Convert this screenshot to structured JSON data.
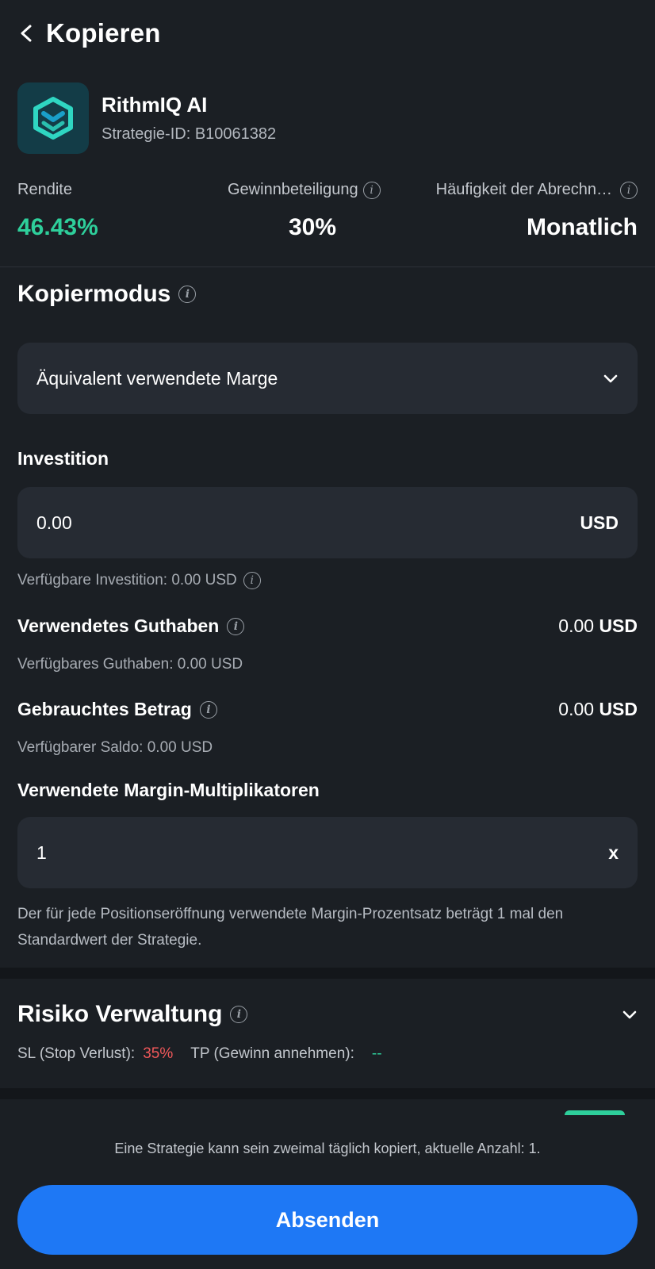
{
  "header": {
    "title": "Kopieren"
  },
  "strategy": {
    "name": "RithmIQ AI",
    "id_text": "Strategie-ID: B10061382"
  },
  "stats": {
    "return_label": "Rendite",
    "return_value": "46.43%",
    "profit_share_label": "Gewinnbeteiligung",
    "profit_share_value": "30%",
    "settlement_label": "Häufigkeit der Abrechn…",
    "settlement_value": "Monatlich"
  },
  "copy_mode": {
    "title": "Kopiermodus",
    "selected": "Äquivalent verwendete Marge"
  },
  "investment": {
    "label": "Investition",
    "value": "0.00",
    "unit": "USD",
    "available": "Verfügbare Investition: 0.00 USD"
  },
  "used_balance": {
    "label": "Verwendetes Guthaben",
    "value": "0.00",
    "unit": "USD",
    "available": "Verfügbares Guthaben: 0.00 USD"
  },
  "used_amount": {
    "label": "Gebrauchtes Betrag",
    "value": "0.00",
    "unit": "USD",
    "available": "Verfügbarer Saldo: 0.00 USD"
  },
  "margin_multiplier": {
    "label": "Verwendete Margin-Multiplikatoren",
    "value": "1",
    "unit": "x",
    "description": "Der für jede Positionseröffnung verwendete Margin-Prozentsatz beträgt 1 mal den Standardwert der Strategie."
  },
  "risk": {
    "title": "Risiko Verwaltung",
    "sl_label": "SL (Stop Verlust):",
    "sl_value": "35%",
    "tp_label": "TP (Gewinn annehmen):",
    "tp_value": "--"
  },
  "footer": {
    "note": "Eine Strategie kann sein zweimal täglich kopiert, aktuelle Anzahl: 1.",
    "submit_label": "Absenden"
  },
  "colors": {
    "accent_green": "#2ecf9b",
    "danger_red": "#f0585a",
    "primary_blue": "#1e78f5",
    "background": "#1b1f24",
    "card": "#262b33"
  }
}
